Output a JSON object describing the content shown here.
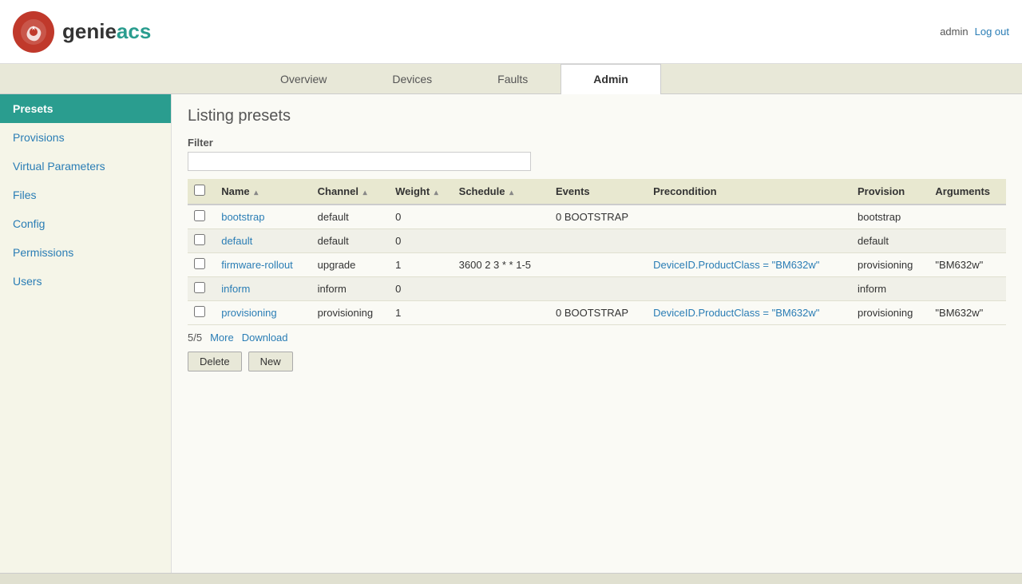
{
  "header": {
    "logo_text_genie": "genie",
    "logo_text_acs": "acs",
    "username": "admin",
    "logout_label": "Log out"
  },
  "nav": {
    "tabs": [
      {
        "id": "overview",
        "label": "Overview",
        "active": false
      },
      {
        "id": "devices",
        "label": "Devices",
        "active": false
      },
      {
        "id": "faults",
        "label": "Faults",
        "active": false
      },
      {
        "id": "admin",
        "label": "Admin",
        "active": true
      }
    ]
  },
  "sidebar": {
    "items": [
      {
        "id": "presets",
        "label": "Presets",
        "active": true
      },
      {
        "id": "provisions",
        "label": "Provisions",
        "active": false
      },
      {
        "id": "virtual-parameters",
        "label": "Virtual Parameters",
        "active": false
      },
      {
        "id": "files",
        "label": "Files",
        "active": false
      },
      {
        "id": "config",
        "label": "Config",
        "active": false
      },
      {
        "id": "permissions",
        "label": "Permissions",
        "active": false
      },
      {
        "id": "users",
        "label": "Users",
        "active": false
      }
    ]
  },
  "main": {
    "page_title": "Listing presets",
    "filter_label": "Filter",
    "filter_placeholder": "",
    "table": {
      "columns": [
        {
          "id": "checkbox",
          "label": ""
        },
        {
          "id": "name",
          "label": "Name",
          "sortable": true
        },
        {
          "id": "channel",
          "label": "Channel",
          "sortable": true
        },
        {
          "id": "weight",
          "label": "Weight",
          "sortable": true
        },
        {
          "id": "schedule",
          "label": "Schedule",
          "sortable": true
        },
        {
          "id": "events",
          "label": "Events"
        },
        {
          "id": "precondition",
          "label": "Precondition"
        },
        {
          "id": "provision",
          "label": "Provision"
        },
        {
          "id": "arguments",
          "label": "Arguments"
        }
      ],
      "rows": [
        {
          "checkbox": false,
          "name": "bootstrap",
          "channel": "default",
          "weight": "0",
          "schedule": "",
          "events": "0 BOOTSTRAP",
          "precondition": "",
          "precondition_link": false,
          "provision": "bootstrap",
          "arguments": ""
        },
        {
          "checkbox": false,
          "name": "default",
          "channel": "default",
          "weight": "0",
          "schedule": "",
          "events": "",
          "precondition": "",
          "precondition_link": false,
          "provision": "default",
          "arguments": ""
        },
        {
          "checkbox": false,
          "name": "firmware-rollout",
          "channel": "upgrade",
          "weight": "1",
          "schedule": "3600 2 3 * * 1-5",
          "events": "",
          "precondition": "DeviceID.ProductClass = \"BM632w\"",
          "precondition_link": true,
          "provision": "provisioning",
          "arguments": "\"BM632w\""
        },
        {
          "checkbox": false,
          "name": "inform",
          "channel": "inform",
          "weight": "0",
          "schedule": "",
          "events": "",
          "precondition": "",
          "precondition_link": false,
          "provision": "inform",
          "arguments": ""
        },
        {
          "checkbox": false,
          "name": "provisioning",
          "channel": "provisioning",
          "weight": "1",
          "schedule": "",
          "events": "0 BOOTSTRAP",
          "precondition": "DeviceID.ProductClass = \"BM632w\"",
          "precondition_link": true,
          "provision": "provisioning",
          "arguments": "\"BM632w\""
        }
      ]
    },
    "pagination": {
      "count": "5/5",
      "more_label": "More",
      "download_label": "Download"
    },
    "buttons": {
      "delete_label": "Delete",
      "new_label": "New"
    }
  }
}
